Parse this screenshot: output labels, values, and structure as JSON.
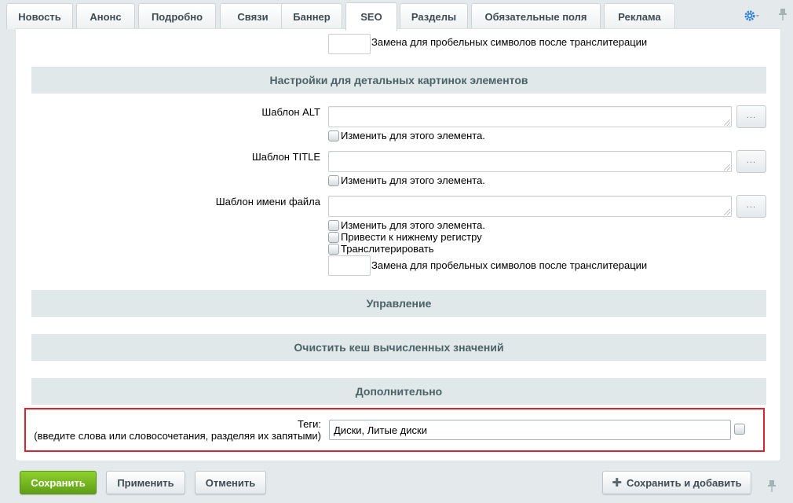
{
  "tabs": [
    {
      "label": "Новость",
      "active": false
    },
    {
      "label": "Анонс",
      "active": false
    },
    {
      "label": "Подробно",
      "active": false
    },
    {
      "label": "Связи",
      "active": false
    },
    {
      "label": "Баннер",
      "active": false
    },
    {
      "label": "SEO",
      "active": true
    },
    {
      "label": "Разделы",
      "active": false
    },
    {
      "label": "Обязательные поля",
      "active": false
    },
    {
      "label": "Реклама",
      "active": false
    }
  ],
  "top_fragment": {
    "space_replace_label": "Замена для пробельных символов после транслитерации"
  },
  "detail_pictures": {
    "header": "Настройки для детальных картинок элементов",
    "alt_label": "Шаблон ALT",
    "title_label": "Шаблон TITLE",
    "filename_label": "Шаблон имени файла",
    "change_for_element": "Изменить для этого элемента.",
    "to_lowercase": "Привести к нижнему регистру",
    "transliterate": "Транслитерировать",
    "space_replace_label": "Замена для пробельных символов после транслитерации",
    "dots": "..."
  },
  "sections": {
    "management": "Управление",
    "clear_cache": "Очистить кеш вычисленных значений",
    "additional": "Дополнительно"
  },
  "tags": {
    "label_line1": "Теги:",
    "label_line2": "(введите слова или словосочетания, разделяя их запятыми)",
    "value": "Диски, Литые диски"
  },
  "buttons": {
    "save": "Сохранить",
    "apply": "Применить",
    "cancel": "Отменить",
    "save_and_add": "Сохранить и добавить"
  },
  "colors": {
    "accent_green": "#6fb31c",
    "highlight_red": "#d9232d",
    "gear_blue": "#2f7fd6"
  }
}
